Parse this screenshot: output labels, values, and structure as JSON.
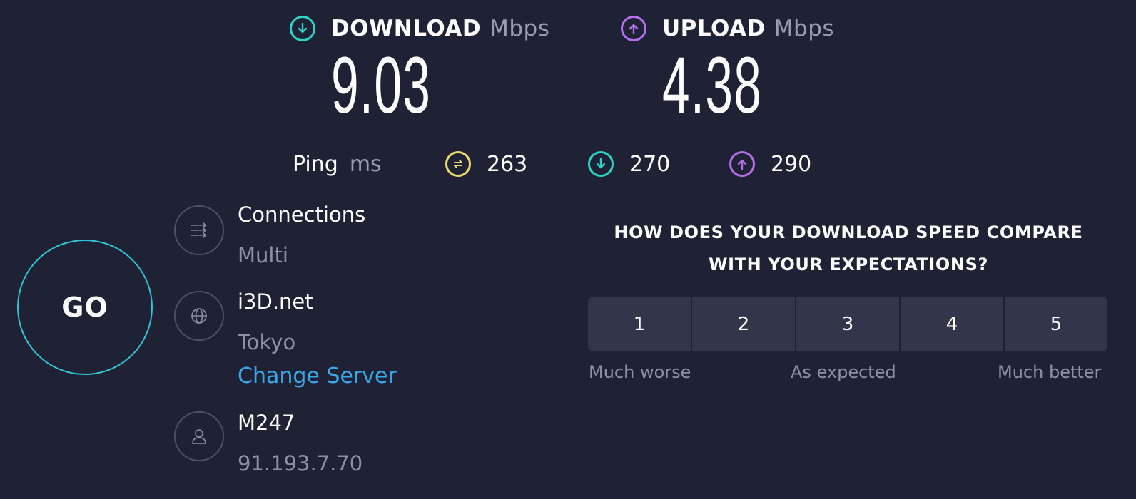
{
  "download": {
    "label": "DOWNLOAD",
    "unit": "Mbps",
    "value": "9.03",
    "color": "#2fd1c5"
  },
  "upload": {
    "label": "UPLOAD",
    "unit": "Mbps",
    "value": "4.38",
    "color": "#b46ee8"
  },
  "ping": {
    "label": "Ping",
    "unit": "ms",
    "idle": "263",
    "download": "270",
    "upload": "290",
    "idle_color": "#e9dc6a"
  },
  "go_button": {
    "label": "GO",
    "ring_color": "#2fc6d6"
  },
  "connections": {
    "title": "Connections",
    "mode": "Multi",
    "icon": "connections-icon"
  },
  "server": {
    "name": "i3D.net",
    "location": "Tokyo",
    "change_label": "Change Server",
    "icon": "globe-icon"
  },
  "provider": {
    "name": "M247",
    "ip": "91.193.7.70",
    "icon": "user-icon"
  },
  "survey": {
    "question": "HOW DOES YOUR DOWNLOAD SPEED COMPARE WITH YOUR EXPECTATIONS?",
    "ratings": [
      "1",
      "2",
      "3",
      "4",
      "5"
    ],
    "low_label": "Much worse",
    "mid_label": "As expected",
    "high_label": "Much better"
  }
}
